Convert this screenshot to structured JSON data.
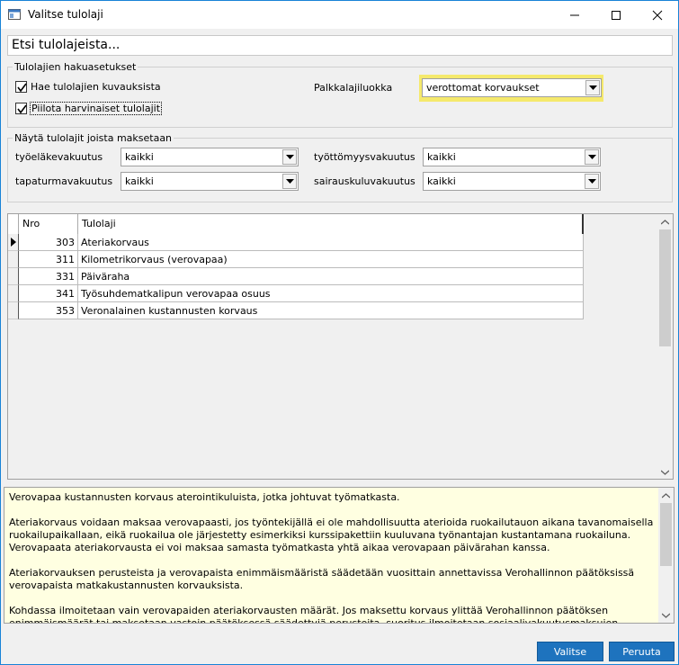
{
  "window": {
    "title": "Valitse tulolaji"
  },
  "search": {
    "value": "Etsi tulolajeista..."
  },
  "search_options": {
    "legend": "Tulolajien hakuasetukset",
    "search_descriptions_label": "Hae tulolajien kuvauksista",
    "search_descriptions_checked": true,
    "hide_rare_label": "Piilota harvinaiset tulolajit",
    "hide_rare_checked": true,
    "wage_class_label": "Palkkalajiluokka",
    "wage_class_value": "verottomat korvaukset",
    "highlight_color": "#f5e96c"
  },
  "payments": {
    "legend": "Näytä tulolajit joista maksetaan",
    "pension_label": "työeläkevakuutus",
    "pension_value": "kaikki",
    "unemployment_label": "työttömyysvakuutus",
    "unemployment_value": "kaikki",
    "accident_label": "tapaturmavakuutus",
    "accident_value": "kaikki",
    "sickness_label": "sairauskuluvakuutus",
    "sickness_value": "kaikki"
  },
  "grid": {
    "headers": {
      "nro": "Nro",
      "tulolaji": "Tulolaji"
    },
    "rows": [
      {
        "nro": "303",
        "name": "Ateriakorvaus"
      },
      {
        "nro": "311",
        "name": "Kilometrikorvaus (verovapaa)"
      },
      {
        "nro": "331",
        "name": "Päiväraha"
      },
      {
        "nro": "341",
        "name": "Työsuhdematkalipun verovapaa osuus"
      },
      {
        "nro": "353",
        "name": "Veronalainen kustannusten korvaus"
      }
    ]
  },
  "description": {
    "p1": "Verovapaa kustannusten korvaus aterointikuluista, jotka johtuvat työmatkasta.",
    "p2": "Ateriakorvaus voidaan maksaa verovapaasti, jos työntekijällä ei ole mahdollisuutta aterioida ruokailutauon aikana tavanomaisella ruokailupaikallaan, eikä ruokailua ole järjestetty esimerkiksi kurssipakettiin kuuluvana työnantajan kustantamana ruokailuna. Verovapaata ateriakorvausta ei voi maksaa samasta työmatkasta yhtä aikaa verovapaan päivärahan kanssa.",
    "p3": "Ateriakorvauksen perusteista ja verovapaista enimmäismääristä säädetään vuosittain annettavissa Verohallinnon päätöksissä verovapaista matkakustannusten korvauksista.",
    "p4": "Kohdassa ilmoitetaan vain verovapaiden ateriakorvausten määrät. Jos maksettu korvaus ylittää Verohallinnon päätöksen enimmäismäärät tai maksetaan vastoin päätöksessä säädettyjä perusteita, suoritus ilmoitetaan sosiaalivakuutusmaksujen alaisena palkkana."
  },
  "buttons": {
    "select": "Valitse",
    "cancel": "Peruuta"
  },
  "colors": {
    "button_blue": "#1e73be",
    "description_bg": "#ffffe1"
  }
}
